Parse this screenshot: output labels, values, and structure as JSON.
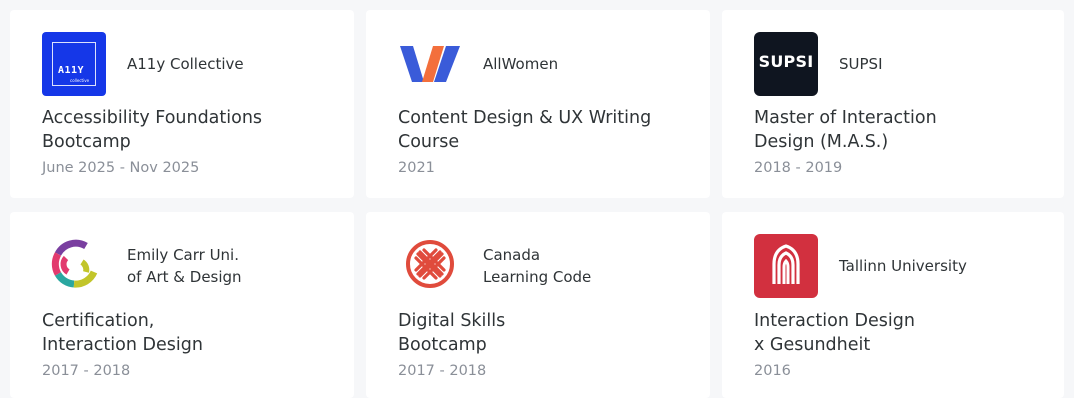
{
  "cards": [
    {
      "org": "A11y Collective",
      "title": "Accessibility Foundations\nBootcamp",
      "date": "June 2025 - Nov 2025",
      "logo_icon": "a11y-collective-logo",
      "logo_text": "A11Y",
      "logo_subtext": "collective",
      "logo_color": "#1537e8"
    },
    {
      "org": "AllWomen",
      "title": "Content Design & UX Writing\nCourse",
      "date": "2021",
      "logo_icon": "allwomen-logo",
      "logo_colors": [
        "#3a5bd9",
        "#f36f3c"
      ]
    },
    {
      "org": "SUPSI",
      "title": "Master of Interaction\nDesign (M.A.S.)",
      "date": "2018 - 2019",
      "logo_icon": "supsi-logo",
      "logo_text": "SUPSI",
      "logo_color": "#0f1520"
    },
    {
      "org": "Emily Carr Uni.\nof Art & Design",
      "title": "Certification,\nInteraction Design",
      "date": "2017 - 2018",
      "logo_icon": "emily-carr-logo",
      "logo_colors": [
        "#c2c52a",
        "#e23a6e",
        "#2aa7a0",
        "#7a3fa0"
      ]
    },
    {
      "org": "Canada\nLearning Code",
      "title": "Digital Skills\nBootcamp",
      "date": "2017 - 2018",
      "logo_icon": "canada-learning-code-logo",
      "logo_color": "#e04b3c"
    },
    {
      "org": "Tallinn University",
      "title": "Interaction Design\nx Gesundheit",
      "date": "2016",
      "logo_icon": "tallinn-university-logo",
      "logo_color": "#d2303f"
    }
  ]
}
